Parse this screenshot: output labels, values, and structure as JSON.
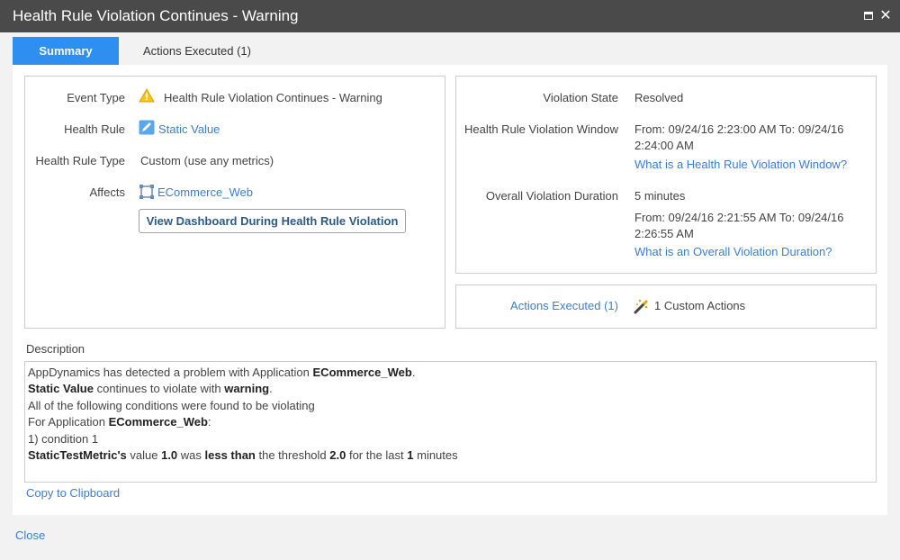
{
  "window": {
    "title": "Health Rule Violation Continues - Warning"
  },
  "tabs": {
    "summary": "Summary",
    "actions_executed": "Actions Executed (1)"
  },
  "summary": {
    "event_type_label": "Event Type",
    "event_type_value": "Health Rule Violation Continues - Warning",
    "health_rule_label": "Health Rule",
    "health_rule_value": "Static Value",
    "health_rule_type_label": "Health Rule Type",
    "health_rule_type_value": "Custom (use any metrics)",
    "affects_label": "Affects",
    "affects_value": "ECommerce_Web",
    "dashboard_button": "View Dashboard During Health Rule Violation"
  },
  "violation": {
    "state_label": "Violation State",
    "state_value": "Resolved",
    "window_label": "Health Rule Violation Window",
    "window_value_line1": "From: 09/24/16 2:23:00 AM To: 09/24/16",
    "window_value_line2": "2:24:00 AM",
    "window_help_link": "What is a Health Rule Violation Window?",
    "duration_label": "Overall Violation Duration",
    "duration_value": "5 minutes",
    "duration_range_line1": "From: 09/24/16 2:21:55 AM To: 09/24/16",
    "duration_range_line2": "2:26:55 AM",
    "duration_help_link": "What is an Overall Violation Duration?"
  },
  "actions": {
    "link": "Actions Executed (1)",
    "value": "1 Custom Actions"
  },
  "description": {
    "label": "Description",
    "line1_a": "AppDynamics has detected a problem with Application ",
    "line1_b": "ECommerce_Web",
    "line1_c": ".",
    "line2_a": "Static Value",
    "line2_b": " continues to violate with ",
    "line2_c": "warning",
    "line2_d": ".",
    "line3": "All of the following conditions were found to be violating",
    "line4_a": "For Application ",
    "line4_b": "ECommerce_Web",
    "line4_c": ":",
    "line5": "1) condition 1",
    "line6_a": "StaticTestMetric's",
    "line6_b": " value ",
    "line6_c": "1.0",
    "line6_d": " was ",
    "line6_e": "less than",
    "line6_f": " the threshold ",
    "line6_g": "2.0",
    "line6_h": " for the last ",
    "line6_i": "1",
    "line6_j": " minutes"
  },
  "footer": {
    "copy_link": "Copy to Clipboard",
    "close_link": "Close"
  },
  "colors": {
    "tab_active": "#2f8ff0",
    "link": "#3b7ed3",
    "titlebar": "#4a4a4a"
  },
  "icons": {
    "event_type": "warning-icon",
    "health_rule": "edit-icon",
    "affects": "topology-icon",
    "actions": "wand-icon"
  }
}
